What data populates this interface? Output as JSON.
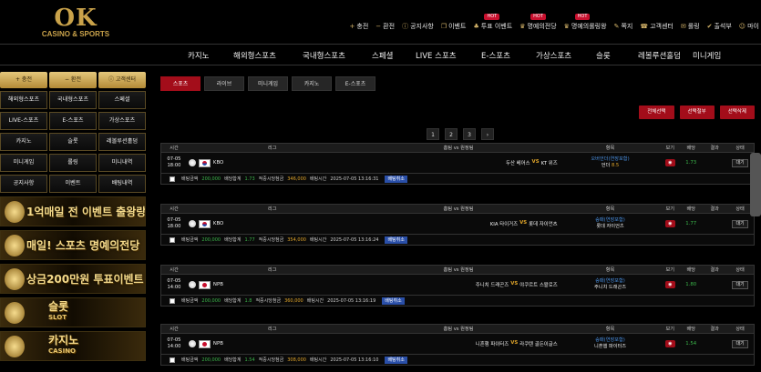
{
  "brand": {
    "logo_big": "OK",
    "logo_small": "CASINO & SPORTS"
  },
  "topnav": [
    {
      "icon": "plus-icon",
      "glyph": "+",
      "label": "충전",
      "hot": ""
    },
    {
      "icon": "minus-icon",
      "glyph": "−",
      "label": "환전",
      "hot": ""
    },
    {
      "icon": "info-icon",
      "glyph": "ⓘ",
      "label": "공지사항",
      "hot": ""
    },
    {
      "icon": "gift-icon",
      "glyph": "❐",
      "label": "이벤트",
      "hot": ""
    },
    {
      "icon": "vote-icon",
      "glyph": "♣",
      "label": "투표 이벤트",
      "hot": "HOT"
    },
    {
      "icon": "trophy-icon",
      "glyph": "♛",
      "label": "명예의전당",
      "hot": "HOT"
    },
    {
      "icon": "trophy-icon",
      "glyph": "♛",
      "label": "명예의롤링왕",
      "hot": "HOT"
    },
    {
      "icon": "note-icon",
      "glyph": "✎",
      "label": "쪽지",
      "hot": ""
    },
    {
      "icon": "headset-icon",
      "glyph": "☎",
      "label": "고객센터",
      "hot": ""
    },
    {
      "icon": "chat-icon",
      "glyph": "✉",
      "label": "롤링",
      "hot": ""
    },
    {
      "icon": "check-icon",
      "glyph": "✔",
      "label": "출석부",
      "hot": ""
    },
    {
      "icon": "user-icon",
      "glyph": "☺",
      "label": "마이",
      "hot": ""
    }
  ],
  "mainnav": [
    "카지노",
    "해외형스포츠",
    "국내형스포츠",
    "스페셜",
    "LIVE 스포츠",
    "E-스포츠",
    "가상스포츠",
    "슬롯",
    "레볼루션홀덤",
    "미니게임"
  ],
  "sidebar": {
    "top_buttons": [
      "+ 충전",
      "− 환전",
      "ⓘ 고객센터"
    ],
    "grid": [
      "해외형스포츠",
      "국내형스포츠",
      "스페셜",
      "LIVE-스포츠",
      "E-스포츠",
      "가상스포츠",
      "카지노",
      "슬롯",
      "레볼루션홀덤",
      "미니게임",
      "롤링",
      "미니내역",
      "공지사항",
      "이벤트",
      "배팅내역"
    ],
    "banners": [
      {
        "title": "1억매일 전 이벤트 출왕랑이벤트",
        "sub": ""
      },
      {
        "title": "매일! 스포츠 명예의전당",
        "sub": ""
      },
      {
        "title": "상금200만원 투표이벤트",
        "sub": ""
      },
      {
        "title": "슬롯",
        "sub": "SLOT"
      },
      {
        "title": "카지노",
        "sub": "CASINO"
      }
    ]
  },
  "tabs": [
    "스포츠",
    "라이브",
    "미니게임",
    "카지노",
    "E-스포츠"
  ],
  "actions": [
    "전체선택",
    "선택철부",
    "선택삭제"
  ],
  "pager": [
    "1",
    "2",
    "3",
    "›"
  ],
  "columns": {
    "time": "시간",
    "league": "리그",
    "match": "홈팀 vs 원정팀",
    "pick": "항목",
    "view": "보기",
    "odds": "배당",
    "result": "결과",
    "state": "상태"
  },
  "bets": [
    {
      "date": "07-05",
      "time": "18:00",
      "flag": "kr",
      "league": "KBO",
      "home": "두산 베어스",
      "away": "KT 위즈",
      "market": "오버언더(연장포함)",
      "pick": "언더",
      "line": "8.5",
      "odds": "1.73",
      "state": "대기",
      "amount": "200,000",
      "total_odds": "1.73",
      "win": "346,000",
      "bet_time": "2025-07-05 13:16:31"
    },
    {
      "date": "07-05",
      "time": "18:00",
      "flag": "kr",
      "league": "KBO",
      "home": "KIA 타이거즈",
      "away": "롯데 자이언츠",
      "market": "승패(연장포함)",
      "pick": "롯데 자이언츠",
      "line": "",
      "odds": "1.77",
      "state": "대기",
      "amount": "200,000",
      "total_odds": "1.77",
      "win": "354,000",
      "bet_time": "2025-07-05 13:16:24"
    },
    {
      "date": "07-05",
      "time": "14:00",
      "flag": "jp",
      "league": "NPB",
      "home": "주니치 드래곤즈",
      "away": "야쿠르트 스왈로즈",
      "market": "승패(연장포함)",
      "pick": "주니치 드래곤즈",
      "line": "",
      "odds": "1.80",
      "state": "대기",
      "amount": "200,000",
      "total_odds": "1.8",
      "win": "360,000",
      "bet_time": "2025-07-05 13:16:19"
    },
    {
      "date": "07-05",
      "time": "14:00",
      "flag": "jp",
      "league": "NPB",
      "home": "니혼햄 파이터즈",
      "away": "라쿠텐 골든이글스",
      "market": "승패(연장포함)",
      "pick": "니혼햄 파이터즈",
      "line": "",
      "odds": "1.54",
      "state": "대기",
      "amount": "200,000",
      "total_odds": "1.54",
      "win": "308,000",
      "bet_time": "2025-07-05 13:16:10"
    }
  ],
  "footer_labels": {
    "amount": "배팅금액",
    "total_odds": "배당합계",
    "win": "적중시당첨금",
    "time": "배팅시간",
    "cancel": "배팅취소"
  }
}
